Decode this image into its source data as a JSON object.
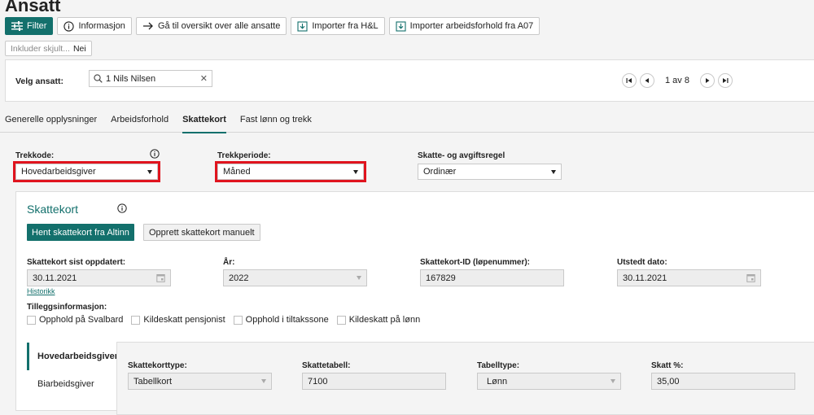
{
  "page": {
    "title": "Ansatt"
  },
  "toolbar": {
    "filter": "Filter",
    "info": "Informasjon",
    "overview": "Gå til oversikt over alle ansatte",
    "import_hl": "Importer fra H&L",
    "import_a07": "Importer arbeidsforhold fra A07"
  },
  "hidden": {
    "label": "Inkluder skjult...",
    "value": "Nei"
  },
  "employee": {
    "label": "Velg ansatt:",
    "search_value": "1 Nils Nilsen",
    "pager_text": "1 av 8"
  },
  "tabs": [
    {
      "label": "Generelle opplysninger"
    },
    {
      "label": "Arbeidsforhold"
    },
    {
      "label": "Skattekort"
    },
    {
      "label": "Fast lønn og trekk"
    }
  ],
  "fields": {
    "trekkode": {
      "label": "Trekkode:",
      "value": "Hovedarbeidsgiver"
    },
    "trekkperiode": {
      "label": "Trekkperiode:",
      "value": "Måned"
    },
    "regel": {
      "label": "Skatte- og avgiftsregel",
      "value": "Ordinær"
    }
  },
  "skattekort": {
    "title": "Skattekort",
    "fetch_btn": "Hent skattekort fra Altinn",
    "manual_btn": "Opprett skattekort manuelt",
    "updated_label": "Skattekort sist oppdatert:",
    "updated_value": "30.11.2021",
    "history_link": "Historikk",
    "year_label": "År:",
    "year_value": "2022",
    "id_label": "Skattekort-ID (løpenummer):",
    "id_value": "167829",
    "issued_label": "Utstedt dato:",
    "issued_value": "30.11.2021",
    "extra_label": "Tilleggsinformasjon:",
    "checkboxes": [
      {
        "label": "Opphold på Svalbard"
      },
      {
        "label": "Kildeskatt pensjonist"
      },
      {
        "label": "Opphold i tiltakssone"
      },
      {
        "label": "Kildeskatt på lønn"
      }
    ],
    "employer_types": [
      {
        "label": "Hovedarbeidsgiver"
      },
      {
        "label": "Biarbeidsgiver"
      }
    ],
    "detail": {
      "type_label": "Skattekorttype:",
      "type_value": "Tabellkort",
      "table_label": "Skattetabell:",
      "table_value": "7100",
      "tabletype_label": "Tabelltype:",
      "tabletype_value": "Lønn",
      "tax_label": "Skatt %:",
      "tax_value": "35,00"
    }
  },
  "colors": {
    "accent": "#13706c",
    "highlight": "#e0141e"
  }
}
